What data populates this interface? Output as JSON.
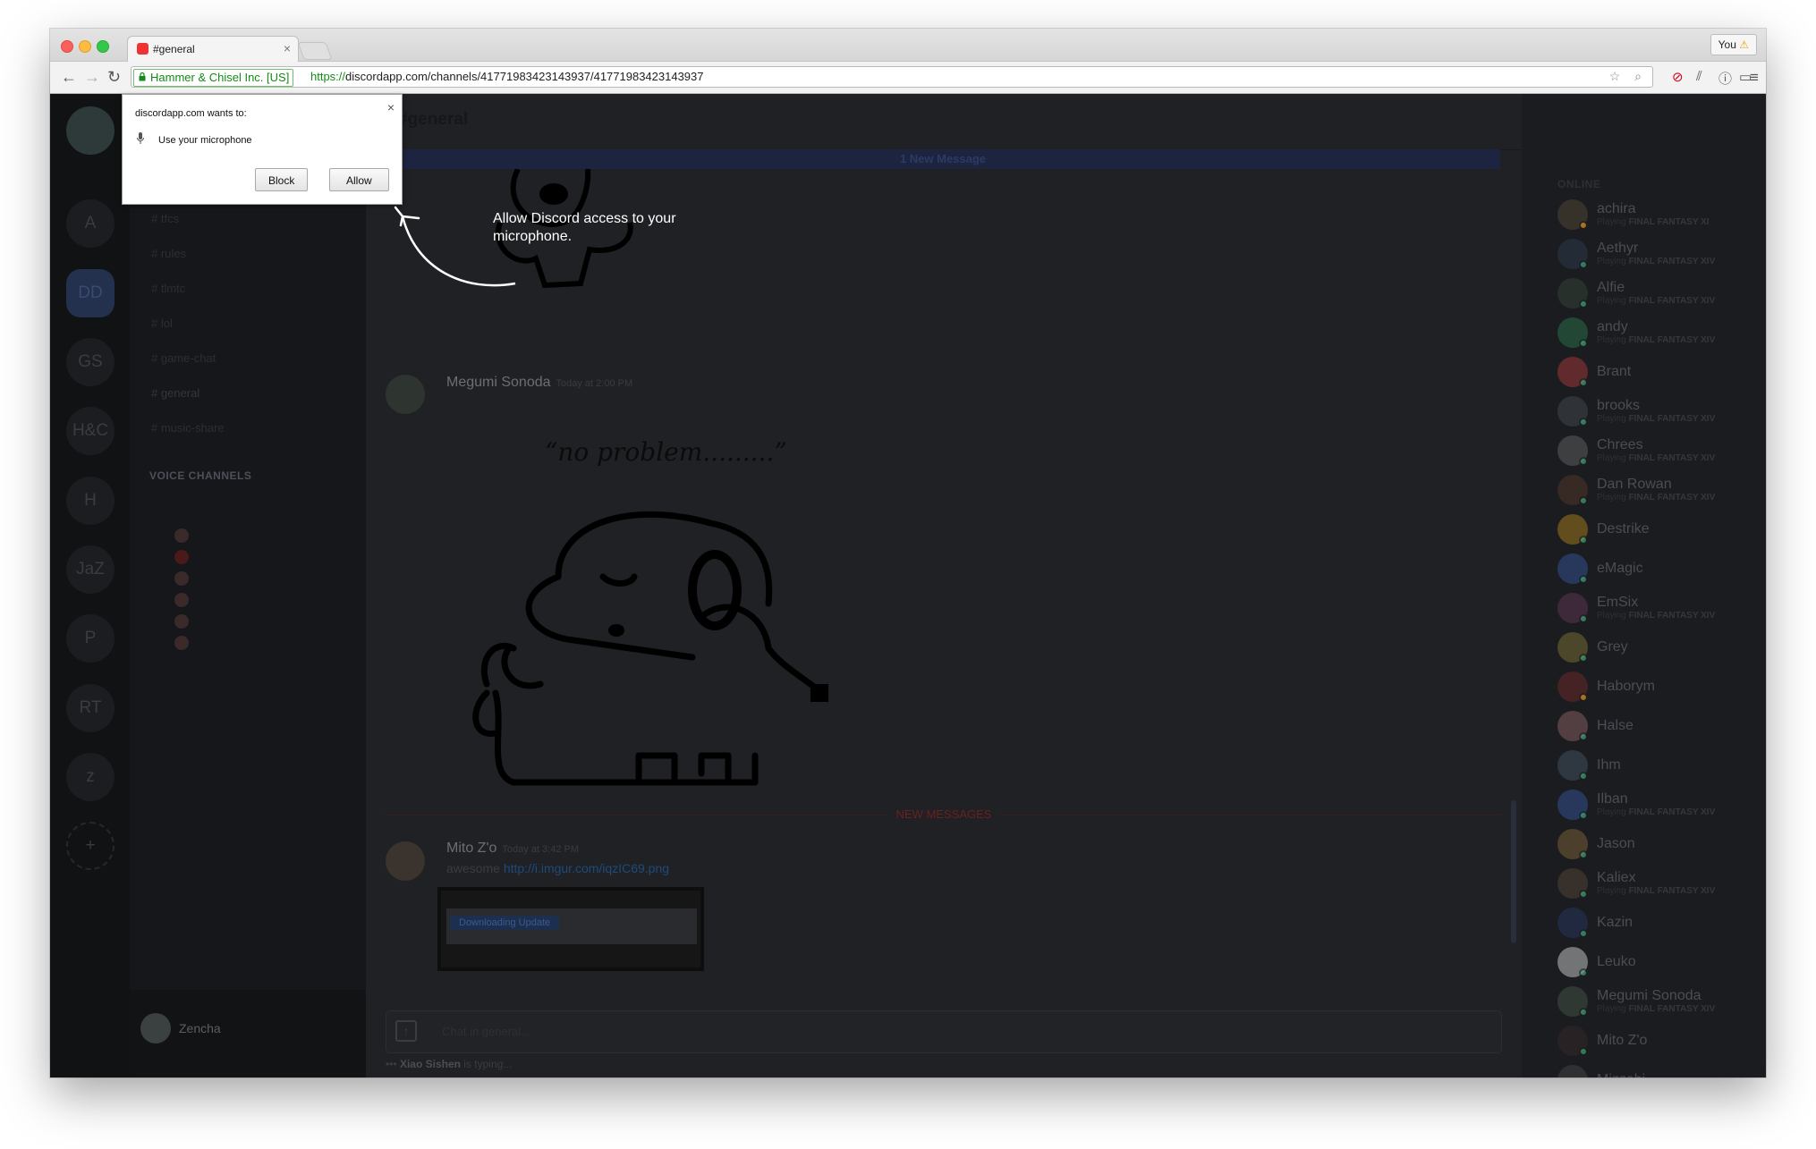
{
  "browser": {
    "tab_title": "#general",
    "user_button": "You",
    "ev_badge": "Hammer & Chisel Inc. [US]",
    "url_scheme": "https://",
    "url_rest": "discordapp.com/channels/417719834231439​37/417719834231439​37"
  },
  "permission": {
    "title": "discordapp.com wants to:",
    "request": "Use your microphone",
    "block_label": "Block",
    "allow_label": "Allow",
    "close_glyph": "×"
  },
  "hint": {
    "text": "Allow Discord access to your microphone."
  },
  "guilds": [
    "A",
    "DD",
    "GS",
    "H&C",
    "H",
    "JaZ",
    "P",
    "RT",
    "z",
    "+"
  ],
  "channels": {
    "text": [
      "# tfcs",
      "# rules",
      "# tlmtc",
      "# lol",
      "# game-chat",
      "# general",
      "# music-share"
    ],
    "voice_header": "VOICE CHANNELS",
    "user_name": "Zencha"
  },
  "main": {
    "channel_title": "#general",
    "new_messages_bar": "1 New Message",
    "message1": {
      "author": "Megumi Sonoda",
      "time": "Today at 2:00 PM",
      "caption": "“no problem.........”"
    },
    "new_divider": "NEW MESSAGES",
    "message2": {
      "author": "Mito Z'o",
      "time": "Today at 3:42 PM",
      "text_prefix": "awesome ",
      "link": "http://i.imgur.com/iqzIC69.png",
      "embed_pill": "Downloading Update"
    },
    "composer_placeholder": "Chat in general...",
    "typing_user": "Xiao Sishen",
    "typing_suffix": " is typing..."
  },
  "members": {
    "header": "ONLINE",
    "list": [
      {
        "name": "achira",
        "game": "FINAL FANTASY XI",
        "status": "#faa61a",
        "avatar": "#5a4b3a"
      },
      {
        "name": "Aethyr",
        "game": "FINAL FANTASY XIV",
        "status": "#43b581",
        "avatar": "#2e3e52"
      },
      {
        "name": "Alfie",
        "game": "FINAL FANTASY XIV",
        "status": "#43b581",
        "avatar": "#3a4a3a"
      },
      {
        "name": "andy",
        "game": "FINAL FANTASY XIV",
        "status": "#43b581",
        "avatar": "#2f7d4f"
      },
      {
        "name": "Brant",
        "game": "",
        "status": "#43b581",
        "avatar": "#b93b3b"
      },
      {
        "name": "brooks",
        "game": "FINAL FANTASY XIV",
        "status": "#43b581",
        "avatar": "#4a4d54"
      },
      {
        "name": "Chrees",
        "game": "FINAL FANTASY XIV",
        "status": "#43b581",
        "avatar": "#6a6a6a"
      },
      {
        "name": "Dan Rowan",
        "game": "FINAL FANTASY XIV",
        "status": "#43b581",
        "avatar": "#5a3a2a"
      },
      {
        "name": "Destrike",
        "game": "",
        "status": "#43b581",
        "avatar": "#b98a1a"
      },
      {
        "name": "eMagic",
        "game": "",
        "status": "#43b581",
        "avatar": "#3a5aa8"
      },
      {
        "name": "EmSix",
        "game": "FINAL FANTASY XIV",
        "status": "#43b581",
        "avatar": "#6a3a5a"
      },
      {
        "name": "Grey",
        "game": "",
        "status": "#43b581",
        "avatar": "#8a7a3a"
      },
      {
        "name": "Haborym",
        "game": "",
        "status": "#faa61a",
        "avatar": "#7a2a2a"
      },
      {
        "name": "Halse",
        "game": "",
        "status": "#43b581",
        "avatar": "#9a6a6a"
      },
      {
        "name": "Ihm",
        "game": "",
        "status": "#43b581",
        "avatar": "#4a5a6a"
      },
      {
        "name": "Ilban",
        "game": "FINAL FANTASY XIV",
        "status": "#43b581",
        "avatar": "#3a5aa8"
      },
      {
        "name": "Jason",
        "game": "",
        "status": "#43b581",
        "avatar": "#8a6a3a"
      },
      {
        "name": "Kaliex",
        "game": "FINAL FANTASY XIV",
        "status": "#43b581",
        "avatar": "#5a4a3a"
      },
      {
        "name": "Kazin",
        "game": "",
        "status": "#43b581",
        "avatar": "#2a3a6a"
      },
      {
        "name": "Leuko",
        "game": "",
        "status": "#43b581",
        "avatar": "#e0e0e0"
      },
      {
        "name": "Megumi Sonoda",
        "game": "FINAL FANTASY XIV",
        "status": "#43b581",
        "avatar": "#4a5a4a"
      },
      {
        "name": "Mito Z'o",
        "game": "",
        "status": "#43b581",
        "avatar": "#3a2a2a"
      },
      {
        "name": "Mizzabi",
        "game": "",
        "status": "#43b581",
        "avatar": "#4a4a4a"
      }
    ],
    "playing_prefix": "Playing "
  }
}
